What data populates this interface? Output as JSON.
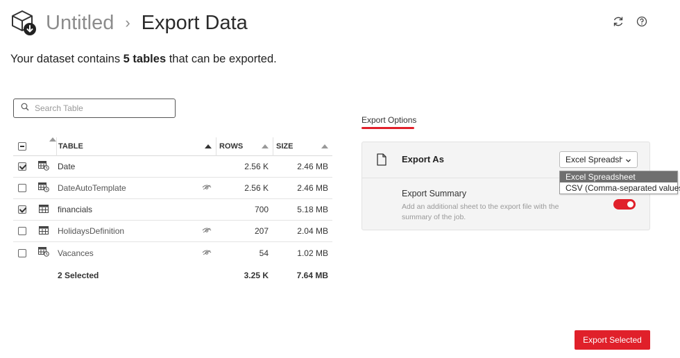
{
  "header": {
    "parent": "Untitled",
    "separator": "›",
    "current": "Export Data",
    "icons": [
      "refresh-icon",
      "help-icon"
    ]
  },
  "subtitle": {
    "prefix": "Your dataset contains ",
    "bold": "5 tables",
    "suffix": " that can be exported."
  },
  "search": {
    "placeholder": "Search Table",
    "value": ""
  },
  "table": {
    "columns": {
      "table": "TABLE",
      "rows": "ROWS",
      "size": "SIZE"
    },
    "rows": [
      {
        "name": "Date",
        "rows": "2.56 K",
        "size": "2.46 MB",
        "checked": true,
        "hidden": false
      },
      {
        "name": "DateAutoTemplate",
        "rows": "2.56 K",
        "size": "2.46 MB",
        "checked": false,
        "hidden": true
      },
      {
        "name": "financials",
        "rows": "700",
        "size": "5.18 MB",
        "checked": true,
        "hidden": false
      },
      {
        "name": "HolidaysDefinition",
        "rows": "207",
        "size": "2.04 MB",
        "checked": false,
        "hidden": true
      },
      {
        "name": "Vacances",
        "rows": "54",
        "size": "1.02 MB",
        "checked": false,
        "hidden": true
      }
    ],
    "footer": {
      "selected": "2 Selected",
      "rows": "3.25 K",
      "size": "7.64 MB"
    }
  },
  "options": {
    "tab": "Export Options",
    "export_as_label": "Export As",
    "export_as_value": "Excel Spreadsheet",
    "dropdown_options": [
      "Excel Spreadsheet",
      "CSV (Comma-separated values)"
    ],
    "summary_title": "Export Summary",
    "summary_desc": "Add an additional sheet to the export file with the summary of the job.",
    "summary_enabled": true
  },
  "actions": {
    "export_button": "Export Selected"
  },
  "colors": {
    "accent": "#e0202a",
    "muted": "#8c8c8c"
  }
}
